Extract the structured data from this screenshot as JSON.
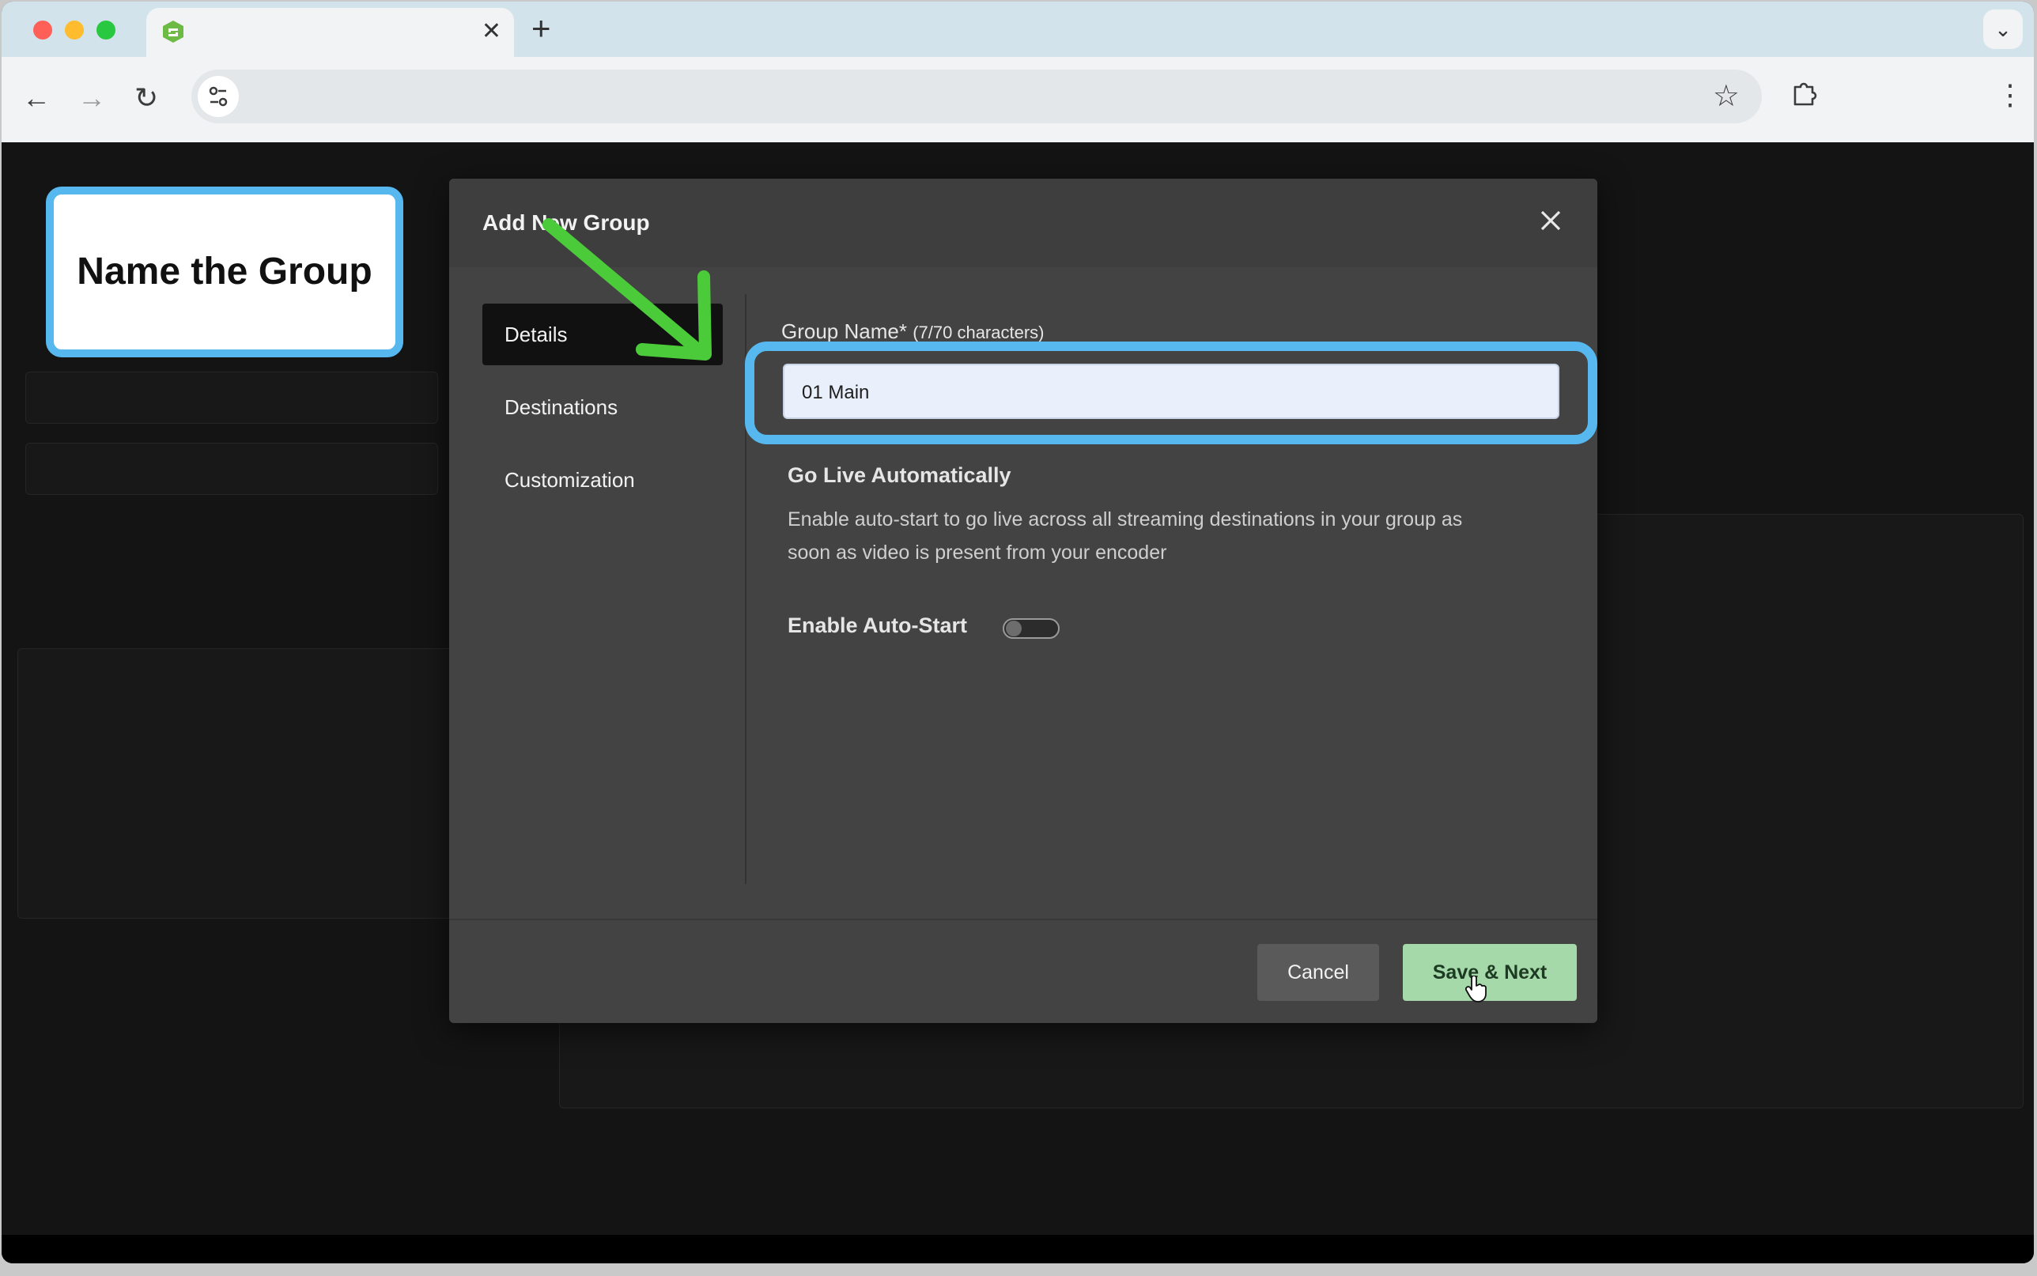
{
  "browser": {
    "tab_close": "✕",
    "new_tab": "+",
    "tab_menu": "⌄",
    "back": "←",
    "forward": "→",
    "reload": "↻",
    "star": "☆",
    "menu": "⋮",
    "traffic_colors": [
      "#fe5f57",
      "#febc2e",
      "#28c840"
    ],
    "favicon_color": "#6dbb45"
  },
  "modal": {
    "title": "Add New Group",
    "menu": [
      {
        "label": "Details",
        "active": true
      },
      {
        "label": "Destinations",
        "active": false
      },
      {
        "label": "Customization",
        "active": false
      }
    ],
    "group_name_label": "Group Name*",
    "group_name_count": "(7/70 characters)",
    "group_name_value": "01 Main",
    "section_title": "Go Live Automatically",
    "section_desc": "Enable auto-start to go live across all streaming destinations in your group as soon as video is present from your encoder",
    "toggle_label": "Enable Auto-Start",
    "toggle_on": false,
    "cancel_label": "Cancel",
    "save_label": "Save & Next"
  },
  "annotation": {
    "callout_text": "Name the Group",
    "accent_color": "#56b8ee",
    "arrow_color": "#4ccb3a"
  },
  "colors": {
    "save_button": "#a6d9aa",
    "modal_bg": "#434343"
  }
}
